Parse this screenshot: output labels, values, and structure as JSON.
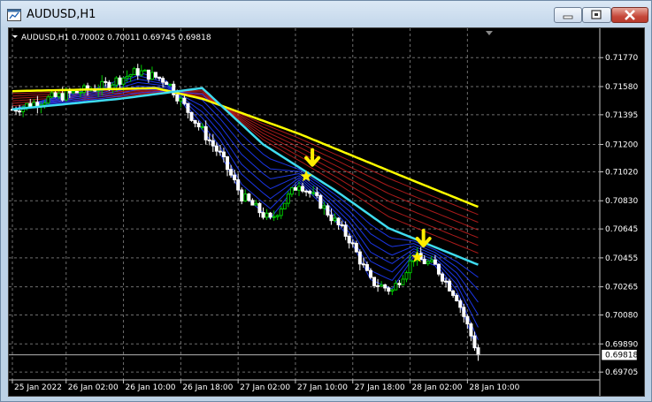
{
  "window": {
    "title": "AUDUSD,H1"
  },
  "chart_header": {
    "text": "AUDUSD,H1  0.70002 0.70011 0.69745 0.69818"
  },
  "price_tag": "0.69818",
  "colors": {
    "bull": "#00c800",
    "bear": "#ffffff",
    "yellow_ma": "#ffff00",
    "cyan_ma": "#3fdcf0",
    "red_ma": "#c81e1e",
    "blue_ma": "#1e3cff",
    "signal": "#ffee00"
  },
  "chart_data": {
    "type": "candlestick",
    "symbol": "AUDUSD",
    "timeframe": "H1",
    "ylim": [
      0.697,
      0.7187
    ],
    "price_ticks": [
      0.7177,
      0.7158,
      0.71395,
      0.712,
      0.7102,
      0.7083,
      0.70645,
      0.70455,
      0.70265,
      0.7008,
      0.6989,
      0.69705
    ],
    "price_tick_labels": [
      "0.71770",
      "0.71580",
      "0.71395",
      "0.71200",
      "0.71020",
      "0.70830",
      "0.70645",
      "0.70455",
      "0.70265",
      "0.70080",
      "0.69890",
      "0.69705"
    ],
    "time_labels": [
      "25 Jan 2022",
      "26 Jan 02:00",
      "26 Jan 10:00",
      "26 Jan 18:00",
      "27 Jan 02:00",
      "27 Jan 10:00",
      "27 Jan 18:00",
      "28 Jan 02:00",
      "28 Jan 10:00"
    ],
    "time_label_bars": [
      0,
      15,
      31,
      47,
      63,
      79,
      95,
      111,
      127
    ],
    "bars_shown": 131,
    "last_close": 0.69818,
    "key_closes": [
      {
        "bar": 0,
        "close": 0.7143
      },
      {
        "bar": 10,
        "close": 0.715
      },
      {
        "bar": 25,
        "close": 0.7158
      },
      {
        "bar": 35,
        "close": 0.7168
      },
      {
        "bar": 43,
        "close": 0.7162
      },
      {
        "bar": 52,
        "close": 0.7132
      },
      {
        "bar": 58,
        "close": 0.7113
      },
      {
        "bar": 64,
        "close": 0.7086
      },
      {
        "bar": 72,
        "close": 0.707
      },
      {
        "bar": 80,
        "close": 0.7095
      },
      {
        "bar": 86,
        "close": 0.7081
      },
      {
        "bar": 94,
        "close": 0.7058
      },
      {
        "bar": 100,
        "close": 0.703
      },
      {
        "bar": 106,
        "close": 0.7024
      },
      {
        "bar": 112,
        "close": 0.7046
      },
      {
        "bar": 118,
        "close": 0.704
      },
      {
        "bar": 124,
        "close": 0.702
      },
      {
        "bar": 130,
        "close": 0.69818
      }
    ],
    "series": [
      {
        "points": [
          {
            "bar": 0,
            "value": 0.7155
          },
          {
            "bar": 40,
            "value": 0.7157
          },
          {
            "bar": 53,
            "value": 0.715
          },
          {
            "bar": 80,
            "value": 0.7127
          },
          {
            "bar": 110,
            "value": 0.7098
          },
          {
            "bar": 130,
            "value": 0.7079
          }
        ]
      },
      {
        "points": [
          {
            "bar": 0,
            "value": 0.7143
          },
          {
            "bar": 30,
            "value": 0.715
          },
          {
            "bar": 53,
            "value": 0.7157
          },
          {
            "bar": 70,
            "value": 0.712
          },
          {
            "bar": 90,
            "value": 0.709
          },
          {
            "bar": 105,
            "value": 0.7065
          },
          {
            "bar": 130,
            "value": 0.7041
          }
        ]
      }
    ],
    "signals": [
      {
        "bar": 82,
        "price": 0.7099,
        "type": "sell"
      },
      {
        "bar": 113,
        "price": 0.7046,
        "type": "sell"
      }
    ]
  }
}
